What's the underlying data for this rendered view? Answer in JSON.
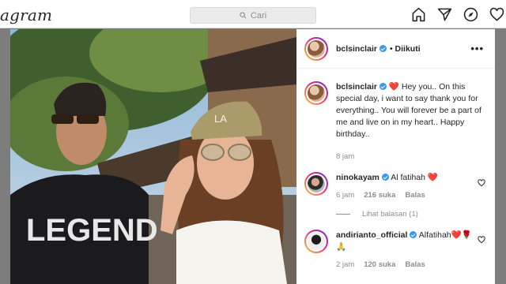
{
  "topbar": {
    "logo_text": "agram",
    "search_placeholder": "Cari",
    "nav_icons": [
      "home-icon",
      "direct-icon",
      "explore-icon",
      "activity-heart-icon"
    ]
  },
  "photo": {
    "shirt_text": "LEGEND",
    "cap_text": "LA"
  },
  "post": {
    "author": "bclsinclair",
    "follow_status": "• Diikuti",
    "more_label": "•••",
    "caption": "❤️ Hey you.. On this special day, i want to say thank you for everything.. You will forever be a part of me and live on in my heart.. Happy birthday..",
    "time": "8 jam"
  },
  "comments": [
    {
      "user": "ninokayam",
      "text": "Al fatihah ❤️",
      "time": "6 jam",
      "likes": "216 suka",
      "reply": "Balas",
      "view_replies": "Lihat balasan (1)"
    },
    {
      "user": "andirianto_official",
      "text": "Alfatihah❤️🌹",
      "text2": "🙏",
      "time": "2 jam",
      "likes": "120 suka",
      "reply": "Balas"
    }
  ],
  "colors": {
    "verified": "#3897f0",
    "muted": "#8e8e8e",
    "text": "#262626"
  }
}
